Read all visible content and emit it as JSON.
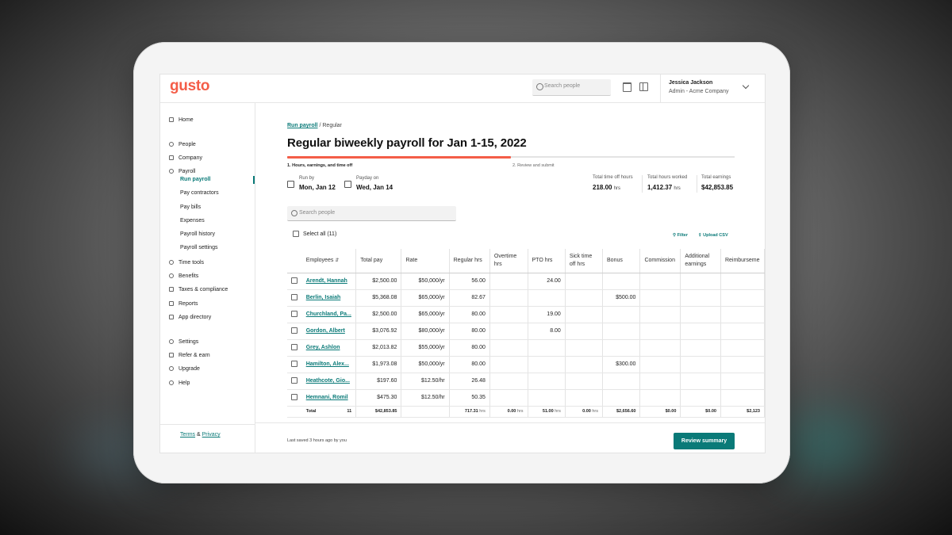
{
  "brand": {
    "logo": "gusto",
    "accent": "#f45d48",
    "teal": "#0a7a78"
  },
  "topbar": {
    "search_placeholder": "Search people",
    "user_name": "Jessica Jackson",
    "user_role": "Admin - Acme Company"
  },
  "sidebar": {
    "items": [
      "Home",
      "People",
      "Company",
      "Payroll"
    ],
    "payroll_sub": [
      "Run payroll",
      "Pay contractors",
      "Pay bills",
      "Expenses",
      "Payroll history",
      "Payroll settings"
    ],
    "items2": [
      "Time tools",
      "Benefits",
      "Taxes & compliance",
      "Reports",
      "App directory"
    ],
    "items3": [
      "Settings",
      "Refer & earn",
      "Upgrade",
      "Help"
    ],
    "footer": {
      "terms": "Terms",
      "amp": "&",
      "privacy": "Privacy"
    }
  },
  "main": {
    "breadcrumb": {
      "link": "Run payroll",
      "sep": "/",
      "current": "Regular"
    },
    "title": "Regular biweekly payroll for Jan 1-15, 2022",
    "progress": 0.5,
    "step1": "1. Hours, earnings, and time off",
    "step2": "2. Review and submit",
    "run_by_label": "Run by",
    "run_by_value": "Mon, Jan 12",
    "payday_label": "Payday on",
    "payday_value": "Wed, Jan 14",
    "stats": [
      {
        "label": "Total time off hours",
        "value": "218.00",
        "unit": "hrs"
      },
      {
        "label": "Total hours worked",
        "value": "1,412.37",
        "unit": "hrs"
      },
      {
        "label": "Total earnings",
        "value": "$42,853.85",
        "unit": ""
      }
    ],
    "search_placeholder": "Search people",
    "select_all": "Select all (11)",
    "filter": "Filter",
    "upload": "Upload CSV",
    "last_saved": "Last saved 3 hours ago by you",
    "cta": "Review summary"
  },
  "table": {
    "headers": [
      "Employees",
      "Total pay",
      "Rate",
      "Regular hrs",
      "Overtime hrs",
      "PTO hrs",
      "Sick time off hrs",
      "Bonus",
      "Commission",
      "Additional earnings",
      "Reimburseme"
    ],
    "rows": [
      [
        "Arendt, Hannah",
        "$2,500.00",
        "$50,000/yr",
        "56.00",
        "",
        "24.00",
        "",
        "",
        "",
        "",
        ""
      ],
      [
        "Berlin, Isaiah",
        "$5,368.08",
        "$65,000/yr",
        "82.67",
        "",
        "",
        "",
        "$500.00",
        "",
        "",
        ""
      ],
      [
        "Churchland, Pa...",
        "$2,500.00",
        "$65,000/yr",
        "80.00",
        "",
        "19.00",
        "",
        "",
        "",
        "",
        ""
      ],
      [
        "Gordon, Albert",
        "$3,076.92",
        "$80,000/yr",
        "80.00",
        "",
        "8.00",
        "",
        "",
        "",
        "",
        ""
      ],
      [
        "Grey, Ashlon",
        "$2,013.82",
        "$55,000/yr",
        "80.00",
        "",
        "",
        "",
        "",
        "",
        "",
        ""
      ],
      [
        "Hamilton, Alex...",
        "$1,973.08",
        "$50,000/yr",
        "80.00",
        "",
        "",
        "",
        "$300.00",
        "",
        "",
        ""
      ],
      [
        "Heathcote, Gio...",
        "$197.60",
        "$12.50/hr",
        "26.48",
        "",
        "",
        "",
        "",
        "",
        "",
        ""
      ],
      [
        "Hemnani, Romil",
        "$475.30",
        "$12.50/hr",
        "50.35",
        "",
        "",
        "",
        "",
        "",
        "",
        ""
      ]
    ],
    "total": {
      "label": "Total",
      "count": "11",
      "total_pay": "$42,853.85",
      "rate": "",
      "regular": "717.31",
      "overtime": "0.00",
      "pto": "51.00",
      "sick": "0.00",
      "bonus": "$2,656.60",
      "commission": "$0.00",
      "additional": "$0.00",
      "reimb": "$2,123",
      "unit": "hrs"
    }
  }
}
